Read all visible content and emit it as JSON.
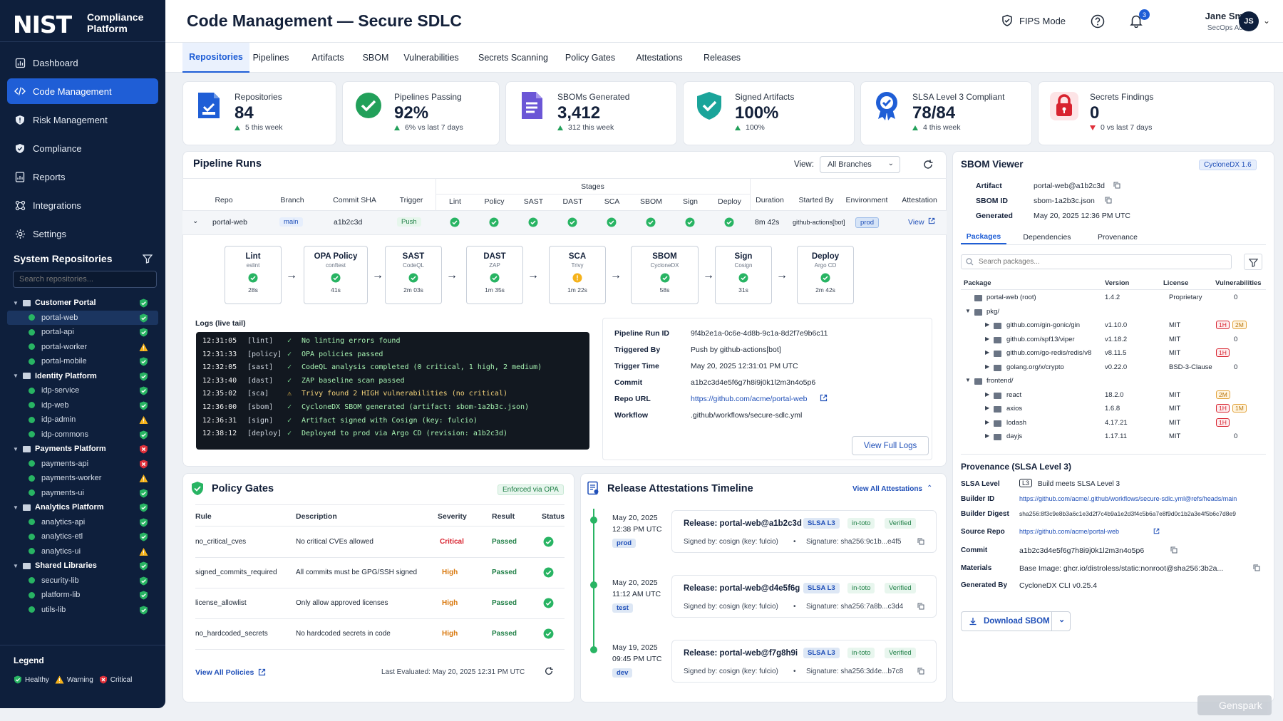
{
  "app": {
    "logo": "NIST",
    "logo_sub1": "Compliance",
    "logo_sub2": "Platform"
  },
  "colors": {
    "accent": "#1f5ed6",
    "sidebar": "#0e1f3c",
    "healthy": "#28b463",
    "warning": "#f5b21b",
    "critical": "#e0303a"
  },
  "nav": [
    {
      "label": "Dashboard",
      "icon": "dashboard-icon"
    },
    {
      "label": "Code Management",
      "icon": "code-icon",
      "active": true
    },
    {
      "label": "Risk Management",
      "icon": "shield-icon"
    },
    {
      "label": "Compliance",
      "icon": "badge-check-icon"
    },
    {
      "label": "Reports",
      "icon": "report-icon"
    },
    {
      "label": "Integrations",
      "icon": "integrations-icon"
    },
    {
      "label": "Settings",
      "icon": "gear-icon"
    }
  ],
  "repos_panel": {
    "title": "System Repositories",
    "search_placeholder": "Search repositories...",
    "tree": [
      {
        "label": "Customer Portal",
        "type": "group",
        "status": "healthy"
      },
      {
        "label": "portal-web",
        "type": "child",
        "status": "healthy",
        "selected": true
      },
      {
        "label": "portal-api",
        "type": "child",
        "status": "healthy"
      },
      {
        "label": "portal-worker",
        "type": "child",
        "status": "warning"
      },
      {
        "label": "portal-mobile",
        "type": "child",
        "status": "healthy"
      },
      {
        "label": "Identity Platform",
        "type": "group",
        "status": "healthy"
      },
      {
        "label": "idp-service",
        "type": "child",
        "status": "healthy"
      },
      {
        "label": "idp-web",
        "type": "child",
        "status": "healthy"
      },
      {
        "label": "idp-admin",
        "type": "child",
        "status": "warning"
      },
      {
        "label": "idp-commons",
        "type": "child",
        "status": "healthy"
      },
      {
        "label": "Payments Platform",
        "type": "group",
        "status": "critical"
      },
      {
        "label": "payments-api",
        "type": "child",
        "status": "critical"
      },
      {
        "label": "payments-worker",
        "type": "child",
        "status": "warning"
      },
      {
        "label": "payments-ui",
        "type": "child",
        "status": "healthy"
      },
      {
        "label": "Analytics Platform",
        "type": "group",
        "status": "healthy"
      },
      {
        "label": "analytics-api",
        "type": "child",
        "status": "healthy"
      },
      {
        "label": "analytics-etl",
        "type": "child",
        "status": "healthy"
      },
      {
        "label": "analytics-ui",
        "type": "child",
        "status": "warning"
      },
      {
        "label": "Shared Libraries",
        "type": "group",
        "status": "healthy"
      },
      {
        "label": "security-lib",
        "type": "child",
        "status": "healthy"
      },
      {
        "label": "platform-lib",
        "type": "child",
        "status": "healthy"
      },
      {
        "label": "utils-lib",
        "type": "child",
        "status": "healthy"
      }
    ]
  },
  "legend": {
    "title": "Legend",
    "healthy": "Healthy",
    "warning": "Warning",
    "critical": "Critical"
  },
  "header": {
    "title": "Code Management — Secure SDLC",
    "fips": "FIPS Mode",
    "notifications": "3",
    "user_name": "Jane Smith",
    "user_role": "SecOps Admin",
    "avatar": "JS"
  },
  "tabs": [
    "Repositories",
    "Pipelines",
    "Artifacts",
    "SBOM",
    "Vulnerabilities",
    "Secrets Scanning",
    "Policy Gates",
    "Attestations",
    "Releases"
  ],
  "stats": [
    {
      "label": "Repositories",
      "value": "84",
      "trend": "5 this week",
      "dir": "up",
      "icon": "repository-icon"
    },
    {
      "label": "Pipelines Passing",
      "value": "92%",
      "trend": "6% vs last 7 days",
      "dir": "up",
      "icon": "check-circle-icon"
    },
    {
      "label": "SBOMs Generated",
      "value": "3,412",
      "trend": "312 this week",
      "dir": "up",
      "icon": "document-icon"
    },
    {
      "label": "Signed Artifacts",
      "value": "100%",
      "trend": "100%",
      "dir": "up",
      "icon": "shield-check-icon"
    },
    {
      "label": "SLSA Level 3 Compliant",
      "value": "78/84",
      "trend": "4 this week",
      "dir": "up",
      "icon": "award-icon"
    },
    {
      "label": "Secrets Findings",
      "value": "0",
      "trend": "0 vs last 7 days",
      "dir": "down",
      "icon": "lock-icon"
    }
  ],
  "pipeline": {
    "title": "Pipeline Runs",
    "view_label": "View:",
    "view_value": "All Branches",
    "stages_header": "Stages",
    "columns": {
      "repo": "Repo",
      "branch": "Branch",
      "sha": "Commit SHA",
      "trigger": "Trigger",
      "duration": "Duration",
      "started_by": "Started By",
      "environment": "Environment",
      "attestation": "Attestation"
    },
    "stage_cols": [
      "Lint",
      "Policy",
      "SAST",
      "DAST",
      "SCA",
      "SBOM",
      "Sign",
      "Deploy"
    ],
    "row": {
      "repo": "portal-web",
      "branch": "main",
      "sha": "a1b2c3d",
      "trigger": "Push",
      "duration": "8m 42s",
      "started_by": "github-actions[bot]",
      "environment": "prod",
      "attestation": "View"
    },
    "stages": [
      {
        "name": "Lint",
        "tool": "eslint",
        "dur": "28s",
        "status": "healthy"
      },
      {
        "name": "OPA Policy",
        "tool": "conftest",
        "dur": "41s",
        "status": "healthy"
      },
      {
        "name": "SAST",
        "tool": "CodeQL",
        "dur": "2m 03s",
        "status": "healthy"
      },
      {
        "name": "DAST",
        "tool": "ZAP",
        "dur": "1m 35s",
        "status": "healthy"
      },
      {
        "name": "SCA",
        "tool": "Trivy",
        "dur": "1m 22s",
        "status": "warning"
      },
      {
        "name": "SBOM",
        "tool": "CycloneDX",
        "dur": "58s",
        "status": "healthy"
      },
      {
        "name": "Sign",
        "tool": "Cosign",
        "dur": "31s",
        "status": "healthy"
      },
      {
        "name": "Deploy",
        "tool": "Argo CD",
        "dur": "2m 42s",
        "status": "healthy"
      }
    ],
    "logs_title": "Logs (live tail)",
    "logs": [
      {
        "time": "12:31:05",
        "stage": "[lint]",
        "msg": "No linting errors found",
        "level": "ok"
      },
      {
        "time": "12:31:33",
        "stage": "[policy]",
        "msg": "OPA policies passed",
        "level": "ok"
      },
      {
        "time": "12:32:05",
        "stage": "[sast]",
        "msg": "CodeQL analysis completed (0 critical, 1 high, 2 medium)",
        "level": "ok"
      },
      {
        "time": "12:33:40",
        "stage": "[dast]",
        "msg": "ZAP baseline scan passed",
        "level": "ok"
      },
      {
        "time": "12:35:02",
        "stage": "[sca]",
        "msg": "Trivy found 2 HIGH vulnerabilities (no critical)",
        "level": "warn"
      },
      {
        "time": "12:36:00",
        "stage": "[sbom]",
        "msg": "CycloneDX SBOM generated (artifact: sbom-1a2b3c.json)",
        "level": "ok"
      },
      {
        "time": "12:36:31",
        "stage": "[sign]",
        "msg": "Artifact signed with Cosign (key: fulcio)",
        "level": "ok"
      },
      {
        "time": "12:38:12",
        "stage": "[deploy]",
        "msg": "Deployed to prod via Argo CD (revision: a1b2c3d)",
        "level": "ok"
      }
    ],
    "details": [
      {
        "k": "Pipeline Run ID",
        "v": "9f4b2e1a-0c6e-4d8b-9c1a-8d2f7e9b6c11"
      },
      {
        "k": "Triggered By",
        "v": "Push by github-actions[bot]"
      },
      {
        "k": "Trigger Time",
        "v": "May 20, 2025 12:31:01 PM UTC"
      },
      {
        "k": "Commit",
        "v": "a1b2c3d4e5f6g7h8i9j0k1l2m3n4o5p6"
      },
      {
        "k": "Repo URL",
        "v": "https://github.com/acme/portal-web"
      },
      {
        "k": "Workflow",
        "v": ".github/workflows/secure-sdlc.yml"
      }
    ],
    "view_full_logs": "View Full Logs"
  },
  "policy": {
    "title": "Policy Gates",
    "enforced": "Enforced via OPA",
    "columns": [
      "Rule",
      "Description",
      "Severity",
      "Result",
      "Status"
    ],
    "rows": [
      {
        "rule": "no_critical_cves",
        "desc": "No critical CVEs allowed",
        "severity": "Critical",
        "result": "Passed"
      },
      {
        "rule": "signed_commits_required",
        "desc": "All commits must be GPG/SSH signed",
        "severity": "High",
        "result": "Passed"
      },
      {
        "rule": "license_allowlist",
        "desc": "Only allow approved licenses",
        "severity": "High",
        "result": "Passed"
      },
      {
        "rule": "no_hardcoded_secrets",
        "desc": "No hardcoded secrets in code",
        "severity": "High",
        "result": "Passed"
      }
    ],
    "view_all": "View All Policies",
    "last_eval": "Last Evaluated: May 20, 2025 12:31 PM UTC"
  },
  "releases": {
    "title": "Release Attestations Timeline",
    "view_all": "View All Attestations",
    "items": [
      {
        "date": "May 20, 2025",
        "time": "12:38 PM UTC",
        "env": "prod",
        "title": "Release: portal-web@a1b2c3d",
        "slsa": "SLSA L3",
        "intoto": "in-toto",
        "verified": "Verified",
        "signed": "Signed by: cosign (key: fulcio)",
        "sig": "Signature: sha256:9c1b...e4f5"
      },
      {
        "date": "May 20, 2025",
        "time": "11:12 AM UTC",
        "env": "test",
        "title": "Release: portal-web@d4e5f6g",
        "slsa": "SLSA L3",
        "intoto": "in-toto",
        "verified": "Verified",
        "signed": "Signed by: cosign (key: fulcio)",
        "sig": "Signature: sha256:7a8b...c3d4"
      },
      {
        "date": "May 19, 2025",
        "time": "09:45 PM UTC",
        "env": "dev",
        "title": "Release: portal-web@f7g8h9i",
        "slsa": "SLSA L3",
        "intoto": "in-toto",
        "verified": "Verified",
        "signed": "Signed by: cosign (key: fulcio)",
        "sig": "Signature: sha256:3d4e...b7c8"
      }
    ]
  },
  "sbom": {
    "title": "SBOM Viewer",
    "format": "CycloneDX 1.6",
    "meta": [
      {
        "k": "Artifact",
        "v": "portal-web@a1b2c3d"
      },
      {
        "k": "SBOM ID",
        "v": "sbom-1a2b3c.json"
      },
      {
        "k": "Generated",
        "v": "May 20, 2025 12:36 PM UTC"
      }
    ],
    "tabs": [
      "Packages",
      "Dependencies",
      "Provenance"
    ],
    "search_placeholder": "Search packages...",
    "columns": [
      "Package",
      "Version",
      "License",
      "Vulnerabilities"
    ],
    "packages": [
      {
        "name": "portal-web (root)",
        "version": "1.4.2",
        "license": "Proprietary",
        "vulns": "0",
        "level": 0,
        "kind": "folder"
      },
      {
        "name": "pkg/",
        "version": "",
        "license": "",
        "vulns": "",
        "level": 0,
        "kind": "folder-open"
      },
      {
        "name": "github.com/gin-gonic/gin",
        "version": "v1.10.0",
        "license": "MIT",
        "vulns": "",
        "badges": [
          "1H",
          "2M"
        ],
        "level": 1
      },
      {
        "name": "github.com/spf13/viper",
        "version": "v1.18.2",
        "license": "MIT",
        "vulns": "0",
        "level": 1
      },
      {
        "name": "github.com/go-redis/redis/v8",
        "version": "v8.11.5",
        "license": "MIT",
        "vulns": "",
        "badges": [
          "1H"
        ],
        "level": 1
      },
      {
        "name": "golang.org/x/crypto",
        "version": "v0.22.0",
        "license": "BSD-3-Clause",
        "vulns": "0",
        "level": 1
      },
      {
        "name": "frontend/",
        "version": "",
        "license": "",
        "vulns": "",
        "level": 0,
        "kind": "folder-open"
      },
      {
        "name": "react",
        "version": "18.2.0",
        "license": "MIT",
        "vulns": "",
        "badges": [
          "2M"
        ],
        "level": 1
      },
      {
        "name": "axios",
        "version": "1.6.8",
        "license": "MIT",
        "vulns": "",
        "badges": [
          "1H",
          "1M"
        ],
        "level": 1
      },
      {
        "name": "lodash",
        "version": "4.17.21",
        "license": "MIT",
        "vulns": "",
        "badges": [
          "1H"
        ],
        "level": 1
      },
      {
        "name": "dayjs",
        "version": "1.17.11",
        "license": "MIT",
        "vulns": "0",
        "level": 1
      }
    ],
    "provenance_title": "Provenance (SLSA Level 3)",
    "provenance": [
      {
        "k": "SLSA Level",
        "v": "Build meets SLSA Level 3",
        "badge": "L3"
      },
      {
        "k": "Builder ID",
        "v": "https://github.com/acme/.github/workflows/secure-sdlc.yml@refs/heads/main",
        "link": true
      },
      {
        "k": "Builder Digest",
        "v": "sha256:8f3c9e8b3a6c1e3d2f7c4b9a1e2d3f4c5b6a7e8f9d0c1b2a3e4f5b6c7d8e9"
      },
      {
        "k": "Source Repo",
        "v": "https://github.com/acme/portal-web",
        "link": true
      },
      {
        "k": "Commit",
        "v": "a1b2c3d4e5f6g7h8i9j0k1l2m3n4o5p6"
      },
      {
        "k": "Materials",
        "v": "Base Image: ghcr.io/distroless/static:nonroot@sha256:3b2a..."
      },
      {
        "k": "Generated By",
        "v": "CycloneDX CLI v0.25.4"
      }
    ],
    "download": "Download SBOM"
  },
  "watermark": "Genspark"
}
